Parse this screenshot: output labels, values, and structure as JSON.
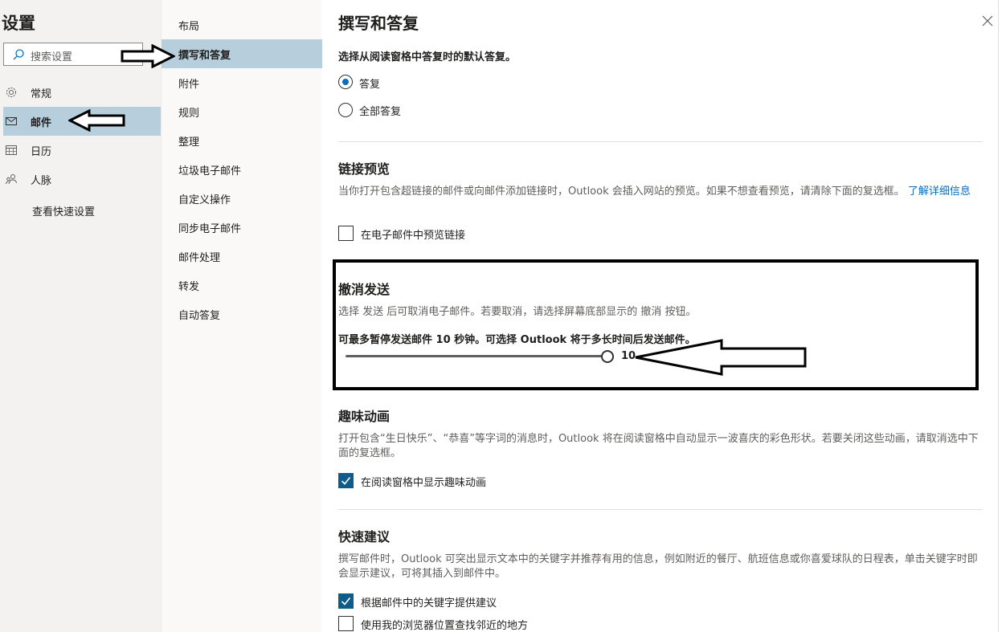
{
  "left": {
    "title": "设置",
    "search_placeholder": "搜索设置",
    "categories": [
      {
        "label": "常规",
        "icon": "gear-icon"
      },
      {
        "label": "邮件",
        "icon": "mail-icon"
      },
      {
        "label": "日历",
        "icon": "calendar-icon"
      },
      {
        "label": "人脉",
        "icon": "people-icon"
      }
    ],
    "quick_settings": "查看快速设置"
  },
  "middle": {
    "items": [
      "布局",
      "撰写和答复",
      "附件",
      "规则",
      "整理",
      "垃圾电子邮件",
      "自定义操作",
      "同步电子邮件",
      "邮件处理",
      "转发",
      "自动答复"
    ]
  },
  "main": {
    "title": "撰写和答复",
    "reply_intro": "选择从阅读窗格中答复时的默认答复。",
    "reply_options": [
      "答复",
      "全部答复"
    ],
    "link_preview": {
      "heading": "链接预览",
      "desc": "当你打开包含超链接的邮件或向邮件添加链接时，Outlook 会插入网站的预览。如果不想查看预览，请清除下面的复选框。",
      "learn_more": "了解详细信息",
      "checkbox": "在电子邮件中预览链接"
    },
    "undo_send": {
      "heading": "撤消发送",
      "desc": "选择 发送 后可取消电子邮件。若要取消，请选择屏幕底部显示的 撤消 按钮。",
      "instruction": "可最多暂停发送邮件 10 秒钟。可选择 Outlook 将于多长时间后发送邮件。",
      "value": "10",
      "max_seconds": 10
    },
    "fun_animations": {
      "heading": "趣味动画",
      "desc": "打开包含“生日快乐”、“恭喜”等字词的消息时，Outlook 将在阅读窗格中自动显示一波喜庆的彩色形状。若要关闭这些动画，请取消选中下面的复选框。",
      "checkbox": "在阅读窗格中显示趣味动画"
    },
    "suggestions": {
      "heading": "快速建议",
      "desc": "撰写邮件时，Outlook 可突出显示文本中的关键字并推荐有用的信息，例如附近的餐厅、航班信息或你喜爱球队的日程表，单击关键字时即会显示建议，可将其插入到邮件中。",
      "checkbox1": "根据邮件中的关键字提供建议",
      "checkbox2": "使用我的浏览器位置查找邻近的地方"
    }
  },
  "colors": {
    "accent": "#0f6cbd",
    "selected_bg": "#b7cedc",
    "checkbox_on": "#0e5c8a"
  }
}
